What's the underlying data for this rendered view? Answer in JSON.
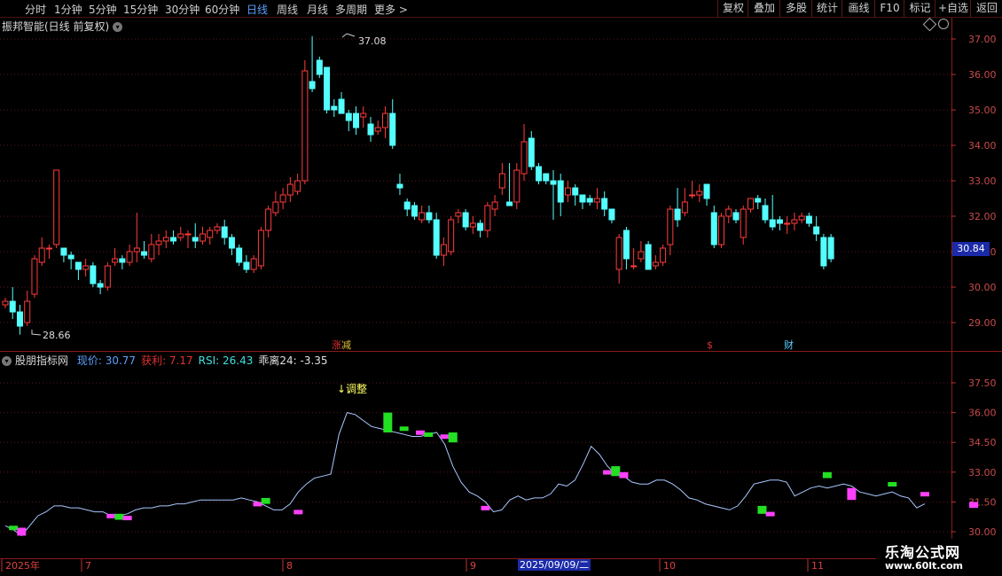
{
  "toolbar": {
    "periods": [
      "分时",
      "1分钟",
      "5分钟",
      "15分钟",
      "30分钟",
      "60分钟",
      "日线",
      "周线",
      "月线",
      "多周期",
      "更多 >"
    ],
    "active_period": "日线",
    "right_buttons": [
      "复权",
      "叠加",
      "多股",
      "统计",
      "画线",
      "F10",
      "标记",
      "+自选",
      "返回"
    ]
  },
  "main_chart": {
    "title": "振邦智能(日线 前复权)",
    "high_label": "37.08",
    "low_label": "28.66",
    "current_price": "30.84",
    "y_ticks": [
      "37.00",
      "36.00",
      "35.00",
      "34.00",
      "33.00",
      "32.00",
      "31.00",
      "30.00",
      "29.00"
    ],
    "events": [
      {
        "text": "涨",
        "color": "#e03030"
      },
      {
        "text": "减",
        "color": "#e0c030"
      },
      {
        "text": "$",
        "color": "#e03030"
      },
      {
        "text": "财",
        "color": "#5ad0ff"
      }
    ]
  },
  "indicator": {
    "name": "股朋指标网",
    "fields": [
      {
        "label": "现价: 30.77",
        "color": "#5aa0ff"
      },
      {
        "label": "获利: 7.17",
        "color": "#e03030"
      },
      {
        "label": "RSI: 26.43",
        "color": "#40e0e0"
      },
      {
        "label": "乖离24: -3.35",
        "color": "#e0e0e0"
      }
    ],
    "annotation": "↓调整",
    "y_ticks": [
      "37.50",
      "36.00",
      "34.50",
      "33.00",
      "31.50",
      "30.00"
    ]
  },
  "x_axis": {
    "labels": [
      "2025年",
      "7",
      "8",
      "9",
      "10",
      "11"
    ],
    "highlight_date": "2025/09/09/二"
  },
  "watermark": {
    "line1": "乐淘公式网",
    "line2": "www.60lt.com"
  },
  "colors": {
    "up": "#ff3b3b",
    "down": "#54ffff",
    "grid": "#5a1818",
    "accent": "#1a2aa8"
  },
  "chart_data": {
    "type": "candlestick",
    "ylim": [
      28.5,
      37.5
    ],
    "candles": [
      [
        29.5,
        29.6,
        29.4,
        29.7
      ],
      [
        29.6,
        29.3,
        29.1,
        30.0
      ],
      [
        29.3,
        28.9,
        28.66,
        29.5
      ],
      [
        29.0,
        29.6,
        28.9,
        29.9
      ],
      [
        29.8,
        30.8,
        29.7,
        30.9
      ],
      [
        30.7,
        31.1,
        30.6,
        31.4
      ],
      [
        31.1,
        31.1,
        30.8,
        31.2
      ],
      [
        31.2,
        33.3,
        31.1,
        33.3
      ],
      [
        31.1,
        30.9,
        30.7,
        31.1
      ],
      [
        30.9,
        30.8,
        30.5,
        31.0
      ],
      [
        30.7,
        30.5,
        30.2,
        30.7
      ],
      [
        30.5,
        30.6,
        30.3,
        30.8
      ],
      [
        30.6,
        30.1,
        30.0,
        30.7
      ],
      [
        30.1,
        30.0,
        29.8,
        30.2
      ],
      [
        30.0,
        30.6,
        29.9,
        30.7
      ],
      [
        30.7,
        30.8,
        30.6,
        31.1
      ],
      [
        30.8,
        30.7,
        30.5,
        30.9
      ],
      [
        30.7,
        31.0,
        30.6,
        31.2
      ],
      [
        31.0,
        31.1,
        30.7,
        32.1
      ],
      [
        31.0,
        30.9,
        30.8,
        31.3
      ],
      [
        30.8,
        31.2,
        30.7,
        31.5
      ],
      [
        31.2,
        31.3,
        30.9,
        31.5
      ],
      [
        31.3,
        31.4,
        31.1,
        31.6
      ],
      [
        31.4,
        31.3,
        31.2,
        31.6
      ],
      [
        31.4,
        31.5,
        31.3,
        31.7
      ],
      [
        31.5,
        31.5,
        31.1,
        31.6
      ],
      [
        31.4,
        31.3,
        31.1,
        31.8
      ],
      [
        31.3,
        31.5,
        31.2,
        31.7
      ],
      [
        31.4,
        31.6,
        31.2,
        31.7
      ],
      [
        31.6,
        31.7,
        31.5,
        31.8
      ],
      [
        31.7,
        31.4,
        31.2,
        31.9
      ],
      [
        31.4,
        31.1,
        30.9,
        31.5
      ],
      [
        31.1,
        30.7,
        30.6,
        31.2
      ],
      [
        30.7,
        30.5,
        30.4,
        30.9
      ],
      [
        30.5,
        30.8,
        30.4,
        30.9
      ],
      [
        30.6,
        31.6,
        30.5,
        31.7
      ],
      [
        31.6,
        32.2,
        31.4,
        32.3
      ],
      [
        32.1,
        32.4,
        32.0,
        32.7
      ],
      [
        32.4,
        32.6,
        32.2,
        32.8
      ],
      [
        32.6,
        32.9,
        32.4,
        33.1
      ],
      [
        32.7,
        33.0,
        32.6,
        33.2
      ],
      [
        33.0,
        36.1,
        32.9,
        36.4
      ],
      [
        35.8,
        35.6,
        35.5,
        37.08
      ],
      [
        36.4,
        36.0,
        35.9,
        36.5
      ],
      [
        36.2,
        35.0,
        34.9,
        36.2
      ],
      [
        35.1,
        35.0,
        34.8,
        35.3
      ],
      [
        35.3,
        34.9,
        34.9,
        35.5
      ],
      [
        34.9,
        34.7,
        34.4,
        35.0
      ],
      [
        34.9,
        34.5,
        34.3,
        35.1
      ],
      [
        34.8,
        34.9,
        34.5,
        35.1
      ],
      [
        34.6,
        34.3,
        34.1,
        34.8
      ],
      [
        34.4,
        34.5,
        34.3,
        34.7
      ],
      [
        34.5,
        34.9,
        34.2,
        35.1
      ],
      [
        34.9,
        34.0,
        33.9,
        35.3
      ],
      [
        32.9,
        32.8,
        32.6,
        33.2
      ],
      [
        32.4,
        32.2,
        32.0,
        32.5
      ],
      [
        32.3,
        32.0,
        31.9,
        32.4
      ],
      [
        31.9,
        32.1,
        31.8,
        32.3
      ],
      [
        32.1,
        31.9,
        31.8,
        32.3
      ],
      [
        31.9,
        30.9,
        30.8,
        32.1
      ],
      [
        30.9,
        31.2,
        30.6,
        31.4
      ],
      [
        31.0,
        31.9,
        30.9,
        32.0
      ],
      [
        32.0,
        32.1,
        31.8,
        32.2
      ],
      [
        32.1,
        31.7,
        31.6,
        32.2
      ],
      [
        31.7,
        31.8,
        31.5,
        32.0
      ],
      [
        31.8,
        31.6,
        31.4,
        31.9
      ],
      [
        31.6,
        32.3,
        31.4,
        32.4
      ],
      [
        32.2,
        32.4,
        32.0,
        32.6
      ],
      [
        32.8,
        33.2,
        32.6,
        33.5
      ],
      [
        32.4,
        32.3,
        32.3,
        33.5
      ],
      [
        32.4,
        33.3,
        32.2,
        33.5
      ],
      [
        33.2,
        34.1,
        33.0,
        34.6
      ],
      [
        34.2,
        33.4,
        33.3,
        34.4
      ],
      [
        33.4,
        33.0,
        32.9,
        33.5
      ],
      [
        33.2,
        33.0,
        32.9,
        33.2
      ],
      [
        33.0,
        32.9,
        31.9,
        33.3
      ],
      [
        33.0,
        32.4,
        32.0,
        33.2
      ],
      [
        32.6,
        32.8,
        32.4,
        33.0
      ],
      [
        32.8,
        32.6,
        32.3,
        32.9
      ],
      [
        32.6,
        32.4,
        32.2,
        32.6
      ],
      [
        32.5,
        32.4,
        32.3,
        32.6
      ],
      [
        32.4,
        32.5,
        32.2,
        32.8
      ],
      [
        32.5,
        32.2,
        32.0,
        32.7
      ],
      [
        32.2,
        31.9,
        31.8,
        32.2
      ],
      [
        30.5,
        31.4,
        30.1,
        31.5
      ],
      [
        31.6,
        30.8,
        30.5,
        31.7
      ],
      [
        30.6,
        30.6,
        30.5,
        31.1
      ],
      [
        30.8,
        31.0,
        30.7,
        31.3
      ],
      [
        31.2,
        30.5,
        30.5,
        31.3
      ],
      [
        30.6,
        30.7,
        30.5,
        30.9
      ],
      [
        30.7,
        31.1,
        30.6,
        31.2
      ],
      [
        31.2,
        32.2,
        30.9,
        32.3
      ],
      [
        32.2,
        31.9,
        31.7,
        32.8
      ],
      [
        32.1,
        32.4,
        32.0,
        32.8
      ],
      [
        32.6,
        32.6,
        32.5,
        33.0
      ],
      [
        32.6,
        32.7,
        32.4,
        32.9
      ],
      [
        32.9,
        32.5,
        32.3,
        32.9
      ],
      [
        32.1,
        31.2,
        31.1,
        32.3
      ],
      [
        31.2,
        32.0,
        31.1,
        32.1
      ],
      [
        32.0,
        32.2,
        31.8,
        32.3
      ],
      [
        32.1,
        31.9,
        31.8,
        32.2
      ],
      [
        31.4,
        32.2,
        31.2,
        32.3
      ],
      [
        32.2,
        32.5,
        32.1,
        32.5
      ],
      [
        32.5,
        32.4,
        32.2,
        32.6
      ],
      [
        32.3,
        31.9,
        31.8,
        32.5
      ],
      [
        31.9,
        31.7,
        31.6,
        32.6
      ],
      [
        31.9,
        31.8,
        31.6,
        32.0
      ],
      [
        31.8,
        31.8,
        31.5,
        32.0
      ],
      [
        31.8,
        31.9,
        31.6,
        32.1
      ],
      [
        31.9,
        32.0,
        31.8,
        32.1
      ],
      [
        32.0,
        31.8,
        31.7,
        32.1
      ],
      [
        31.7,
        31.5,
        31.3,
        32.0
      ],
      [
        31.4,
        30.6,
        30.5,
        31.5
      ],
      [
        31.4,
        30.8,
        30.7,
        31.5
      ]
    ],
    "indicator_line": [
      30.3,
      30.1,
      29.8,
      30.3,
      30.8,
      31.0,
      31.3,
      31.3,
      31.2,
      31.2,
      31.1,
      31.0,
      31.0,
      30.8,
      30.8,
      30.9,
      31.1,
      31.2,
      31.2,
      31.3,
      31.3,
      31.4,
      31.4,
      31.5,
      31.6,
      31.6,
      31.6,
      31.6,
      31.6,
      31.7,
      31.6,
      31.5,
      31.3,
      31.1,
      31.1,
      31.4,
      32.0,
      32.4,
      32.7,
      32.8,
      32.9,
      34.9,
      36.0,
      35.9,
      35.6,
      35.3,
      35.2,
      35.1,
      35.0,
      34.9,
      34.8,
      34.8,
      34.9,
      35.0,
      34.4,
      33.3,
      32.5,
      32.0,
      31.8,
      31.5,
      31.0,
      31.1,
      31.6,
      31.8,
      31.6,
      31.7,
      31.7,
      31.9,
      32.4,
      32.3,
      32.6,
      33.4,
      34.3,
      33.9,
      33.3,
      32.9,
      32.8,
      32.5,
      32.4,
      32.4,
      32.6,
      32.6,
      32.4,
      32.1,
      31.7,
      31.6,
      31.4,
      31.3,
      31.2,
      31.1,
      31.3,
      31.8,
      32.4,
      32.5,
      32.6,
      32.6,
      32.5,
      31.8,
      32.0,
      32.2,
      32.3,
      32.2,
      32.3,
      32.4,
      32.3,
      32.0,
      31.9,
      31.8,
      31.9,
      32.0,
      31.8,
      31.7,
      31.2,
      31.4
    ],
    "indicator_markers": [
      {
        "i": 1,
        "color": "green",
        "from": 30.1,
        "to": 30.3
      },
      {
        "i": 2,
        "color": "magenta",
        "from": 29.8,
        "to": 30.2
      },
      {
        "i": 13,
        "color": "magenta",
        "from": 30.9,
        "to": 30.7
      },
      {
        "i": 14,
        "color": "green",
        "from": 30.9,
        "to": 30.6
      },
      {
        "i": 15,
        "color": "magenta",
        "from": 30.8,
        "to": 30.6
      },
      {
        "i": 31,
        "color": "magenta",
        "from": 31.4,
        "to": 31.5
      },
      {
        "i": 32,
        "color": "green",
        "from": 31.7,
        "to": 31.4
      },
      {
        "i": 36,
        "color": "magenta",
        "from": 31.1,
        "to": 30.9
      },
      {
        "i": 47,
        "color": "green",
        "from": 36.0,
        "to": 35.0
      },
      {
        "i": 49,
        "color": "green",
        "from": 35.3,
        "to": 35.1
      },
      {
        "i": 51,
        "color": "magenta",
        "from": 35.1,
        "to": 34.9
      },
      {
        "i": 52,
        "color": "green",
        "from": 35.0,
        "to": 34.8
      },
      {
        "i": 54,
        "color": "magenta",
        "from": 34.9,
        "to": 34.8
      },
      {
        "i": 55,
        "color": "green",
        "from": 35.0,
        "to": 34.5
      },
      {
        "i": 59,
        "color": "magenta",
        "from": 31.3,
        "to": 31.2
      },
      {
        "i": 74,
        "color": "magenta",
        "from": 33.1,
        "to": 33.0
      },
      {
        "i": 75,
        "color": "green",
        "from": 33.3,
        "to": 32.8
      },
      {
        "i": 76,
        "color": "magenta",
        "from": 33.0,
        "to": 32.7
      },
      {
        "i": 93,
        "color": "green",
        "from": 31.3,
        "to": 30.9
      },
      {
        "i": 94,
        "color": "magenta",
        "from": 31.0,
        "to": 30.9
      },
      {
        "i": 101,
        "color": "green",
        "from": 33.0,
        "to": 32.7
      },
      {
        "i": 104,
        "color": "magenta",
        "from": 32.2,
        "to": 31.6
      },
      {
        "i": 109,
        "color": "green",
        "from": 32.5,
        "to": 32.3
      },
      {
        "i": 113,
        "color": "magenta",
        "from": 32.0,
        "to": 31.9
      },
      {
        "i": 119,
        "color": "magenta",
        "from": 31.5,
        "to": 31.2
      }
    ]
  }
}
